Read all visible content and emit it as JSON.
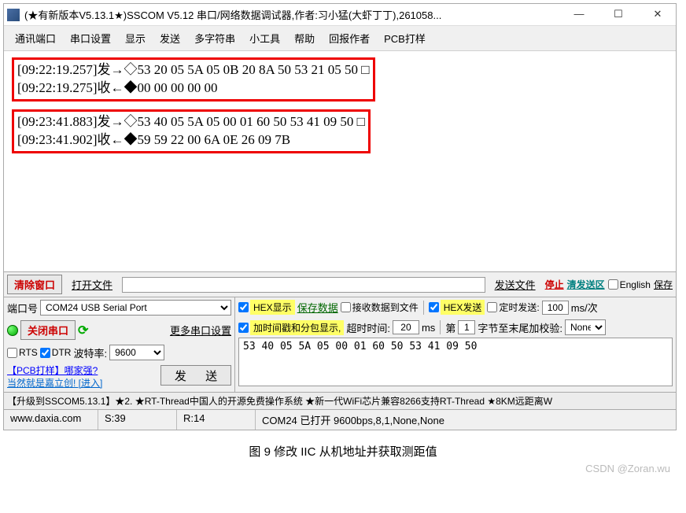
{
  "titlebar": {
    "text": "(★有新版本V5.13.1★)SSCOM V5.12 串口/网络数据调试器,作者:习小猛(大虾丁丁),261058...",
    "min": "—",
    "max": "☐",
    "close": "✕"
  },
  "menubar": {
    "items": [
      "通讯端口",
      "串口设置",
      "显示",
      "发送",
      "多字符串",
      "小工具",
      "帮助",
      "回报作者",
      "PCB打样"
    ]
  },
  "output": {
    "block1_line1": "[09:22:19.257]发→◇53 20 05 5A 05 0B 20 8A 50 53 21 05 50 □",
    "block1_line2": "[09:22:19.275]收←◆00 00 00 00 00",
    "block2_line1": "[09:23:41.883]发→◇53 40 05 5A 05 00 01 60 50 53 41 09 50 □",
    "block2_line2": "[09:23:41.902]收←◆59 59 22 00 6A 0E 26 09 7B"
  },
  "fileRow": {
    "clear": "清除窗口",
    "open": "打开文件",
    "path": "",
    "sendFile": "发送文件",
    "stop": "停止",
    "clearSend": "清发送区",
    "english": "English",
    "save": "保存"
  },
  "leftPanel": {
    "portLabel": "端口号",
    "portValue": "COM24 USB Serial Port",
    "closePort": "关闭串口",
    "moreSettings": "更多串口设置",
    "rts": "RTS",
    "dtr": "DTR",
    "baudLabel": "波特率:",
    "baudValue": "9600",
    "pcbLine1": "【PCB打样】哪家强?",
    "pcbLine2": "当然就是嘉立创! [进入]",
    "sendBtn": "发 送"
  },
  "rightPanel": {
    "hexShow": "HEX显示",
    "saveData": "保存数据",
    "recvToFile": "接收数据到文件",
    "hexSend": "HEX发送",
    "timedSend": "定时发送:",
    "timedVal": "100",
    "timedUnit": "ms/次",
    "timestamp": "加时间戳和分包显示,",
    "timeoutLabel": "超时时间:",
    "timeoutVal": "20",
    "timeoutUnit": "ms",
    "nthLabel": "第",
    "nthVal": "1",
    "nthSuffix": "字节至末尾加校验:",
    "checksum": "None",
    "sendData": "53 40 05 5A 05 00 01 60 50 53 41 09 50"
  },
  "footer": {
    "ad": "【升级到SSCOM5.13.1】★2.  ★RT-Thread中国人的开源免费操作系统  ★新一代WiFi芯片兼容8266支持RT-Thread  ★8KM远距离W",
    "url": "www.daxia.com",
    "s": "S:39",
    "r": "R:14",
    "status": "COM24 已打开  9600bps,8,1,None,None"
  },
  "caption": "图 9 修改 IIC 从机地址并获取测距值",
  "watermark": "CSDN @Zoran.wu"
}
